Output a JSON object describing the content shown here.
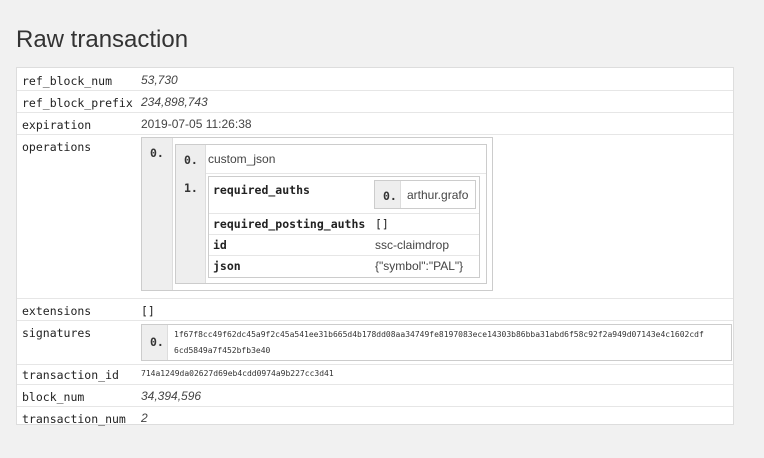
{
  "page": {
    "title": "Raw transaction"
  },
  "fields": {
    "ref_block_num": {
      "key": "ref_block_num",
      "value": "53,730"
    },
    "ref_block_prefix": {
      "key": "ref_block_prefix",
      "value": "234,898,743"
    },
    "expiration": {
      "key": "expiration",
      "value": "2019-07-05 11:26:38"
    },
    "operations": {
      "key": "operations"
    },
    "extensions": {
      "key": "extensions",
      "value": "[]"
    },
    "signatures": {
      "key": "signatures"
    },
    "transaction_id": {
      "key": "transaction_id",
      "value": "714a1249da02627d69eb4cdd0974a9b227cc3d41"
    },
    "block_num": {
      "key": "block_num",
      "value": "34,394,596"
    },
    "transaction_num": {
      "key": "transaction_num",
      "value": "2"
    }
  },
  "operations": [
    {
      "index": "0.",
      "type_index": "0.",
      "type": "custom_json",
      "payload_index": "1.",
      "payload": {
        "required_auths_key": "required_auths",
        "required_auths": [
          {
            "index": "0.",
            "value": "arthur.grafo"
          }
        ],
        "required_posting_auths_key": "required_posting_auths",
        "required_posting_auths": "[]",
        "id_key": "id",
        "id": "ssc-claimdrop",
        "json_key": "json",
        "json": "{\"symbol\":\"PAL\"}"
      }
    }
  ],
  "signatures": [
    {
      "index": "0.",
      "line1": "1f67f8cc49f62dc45a9f2c45a541ee31b665d4b178dd08aa34749fe8197083ece14303b86bba31abd6f58c92f2a949d07143e4c1602cdf",
      "line2": "6cd5849a7f452bfb3e40"
    }
  ]
}
